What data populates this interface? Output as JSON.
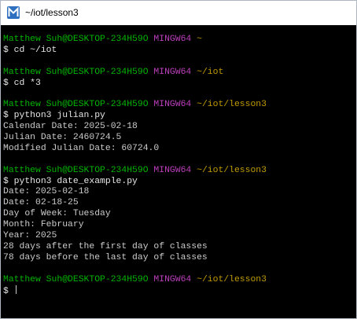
{
  "window": {
    "title": "~/iot/lesson3",
    "app_icon": "mintty-icon"
  },
  "colors": {
    "prompt_user": "#00b400",
    "prompt_system": "#bc3fbc",
    "prompt_path": "#c19c00",
    "text": "#cccccc",
    "background": "#000000"
  },
  "terminal": {
    "blocks": [
      {
        "user": "Matthew Suh@DESKTOP-234H59O",
        "system": "MINGW64",
        "path": "~",
        "command": "$ cd ~/iot",
        "output": []
      },
      {
        "user": "Matthew Suh@DESKTOP-234H59O",
        "system": "MINGW64",
        "path": "~/iot",
        "command": "$ cd *3",
        "output": []
      },
      {
        "user": "Matthew Suh@DESKTOP-234H59O",
        "system": "MINGW64",
        "path": "~/iot/lesson3",
        "command": "$ python3 julian.py",
        "output": [
          "Calendar Date: 2025-02-18",
          "Julian Date: 2460724.5",
          "Modified Julian Date: 60724.0"
        ]
      },
      {
        "user": "Matthew Suh@DESKTOP-234H59O",
        "system": "MINGW64",
        "path": "~/iot/lesson3",
        "command": "$ python3 date_example.py",
        "output": [
          "Date: 2025-02-18",
          "Date: 02-18-25",
          "Day of Week: Tuesday",
          "Month: February",
          "Year: 2025",
          "28 days after the first day of classes",
          "78 days before the last day of classes"
        ]
      },
      {
        "user": "Matthew Suh@DESKTOP-234H59O",
        "system": "MINGW64",
        "path": "~/iot/lesson3",
        "command": "$ ",
        "output": [],
        "active": true
      }
    ]
  }
}
